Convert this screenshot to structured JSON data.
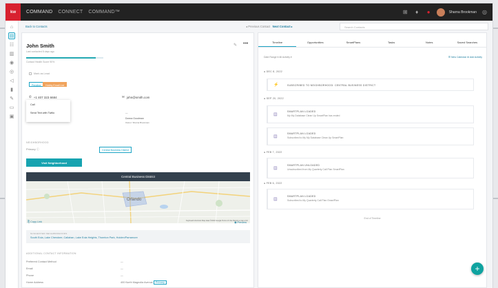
{
  "topbar": {
    "logo": "kw",
    "apps": [
      "COMMAND",
      "CONNECT",
      "COMMAND™"
    ],
    "user_name": "Sharna Brookman"
  },
  "subbar": {
    "back": "Back to Contacts",
    "prev": "◂ Previous Contact",
    "next": "Next Contact ▸",
    "search_placeholder": "Search Contacts"
  },
  "contact": {
    "name": "John Smith",
    "subtitle": "Last contacted 8 days ago",
    "health": "Contact Health Score 90%",
    "health_fraction": 0.9,
    "checkbox": "Mark as Lead",
    "tags": [
      "Pending",
      "Hobby Email List"
    ],
    "phone": "+1 407 323 6684",
    "email": "john@smith.com",
    "menu": [
      "Call",
      "Send Text with Twilio"
    ],
    "owner_dash": "—",
    "owner_name": "Donna Goodman",
    "owner_sub": "Owner: Sharna Brookman"
  },
  "neighborhood": {
    "section": "NEIGHBORHOOD",
    "primary": "Primary",
    "tag": "Central Business District",
    "visit_button": "Visit Neighborhood",
    "map_title": "Central Business District",
    "map_city": "Orlando",
    "map_attr": "Keyboard shortcuts   Map data ©2022 Google   Terms of Use   Report a map error",
    "copy_link": "Copy Link",
    "preview": "Preview",
    "nearby_header": "SUGGESTED NEIGHBORHOODS",
    "nearby_list": "South Eola, Lake Cherokee, Callahan, Lake Eola Heights, Thornton Park, Holden/Parramore"
  },
  "additional": {
    "section": "ADDITIONAL CONTACT INFORMATION",
    "rows": [
      {
        "label": "Preferred Contact Method",
        "value": "—"
      },
      {
        "label": "Email",
        "value": "—"
      },
      {
        "label": "Phone",
        "value": "—"
      },
      {
        "label": "Home Address",
        "value": "400 North Magnolia Avenue"
      }
    ],
    "primary_badge": "Primary"
  },
  "timeline": {
    "tabs": [
      "Timeline",
      "Opportunities",
      "SmartPlans",
      "Tasks",
      "Notes",
      "Saved Searches"
    ],
    "filter_left": "Date Range ▾    All Activity ▾",
    "actions": "☰ New Calendar    ⊕ Add Activity",
    "end": "End of Timeline",
    "groups": [
      {
        "date": "DEC 8, 2022",
        "items": [
          {
            "icon": "subscribe-icon",
            "title": "SUBSCRIBED TO NEIGHBORHOOD: CENTRAL BUSINESS DISTRICT",
            "desc": ""
          }
        ]
      },
      {
        "date": "SEP 20, 2022",
        "items": [
          {
            "icon": "smartplan-icon",
            "title": "SMARTPLAN LOADED",
            "desc": "My My Database Clean Up SmartPlan has ended"
          },
          {
            "icon": "smartplan-icon",
            "title": "SMARTPLAN LOADED",
            "desc": "Subscribed to My My Database Clean Up SmartPlan"
          }
        ]
      },
      {
        "date": "FEB 7, 2022",
        "items": [
          {
            "icon": "smartplan-icon",
            "title": "SMARTPLAN UNLOADED",
            "desc": "Unsubscribed from My Quarterly Call Plan SmartPlan"
          }
        ]
      },
      {
        "date": "FEB 6, 2022",
        "items": [
          {
            "icon": "smartplan-icon",
            "title": "SMARTPLAN LOADED",
            "desc": "Subscribed to My Quarterly Call Plan SmartPlan"
          }
        ]
      }
    ]
  },
  "fab": "+",
  "colors": {
    "accent": "#1aa3c4",
    "brand": "#d8212f",
    "teal": "#17a3b0",
    "orange": "#f0a35c"
  }
}
